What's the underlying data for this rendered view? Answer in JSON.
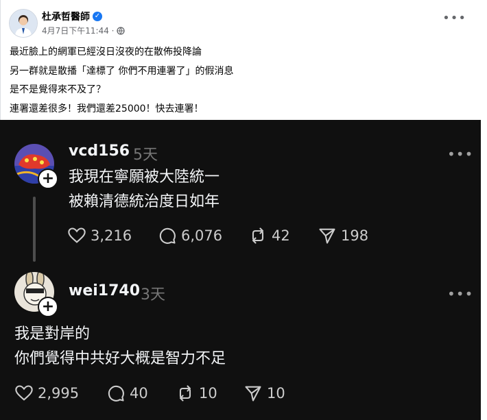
{
  "facebook_post": {
    "author": "杜承哲醫師",
    "timestamp": "4月7日下午11:44 · ",
    "lines": [
      "最近臉上的網軍已經沒日沒夜的在散佈投降論",
      "另一群就是散播「達標了 你們不用連署了」的假消息",
      "是不是覺得來不及了？",
      "連署還差很多！我們還差25000！快去連署！"
    ]
  },
  "threads": [
    {
      "username": "vcd156",
      "time": "5天",
      "lines": [
        "我現在寧願被大陸統一",
        "被賴清德統治度日如年"
      ],
      "likes": "3,216",
      "comments": "6,076",
      "reposts": "42",
      "shares": "198"
    },
    {
      "username": "wei1740",
      "time": "3天",
      "lines": [
        "我是對岸的",
        "你們覺得中共好大概是智力不足"
      ],
      "likes": "2,995",
      "comments": "40",
      "reposts": "10",
      "shares": "10"
    }
  ],
  "colors": {
    "verified": "#1877f2",
    "threads_bg": "#101010"
  }
}
